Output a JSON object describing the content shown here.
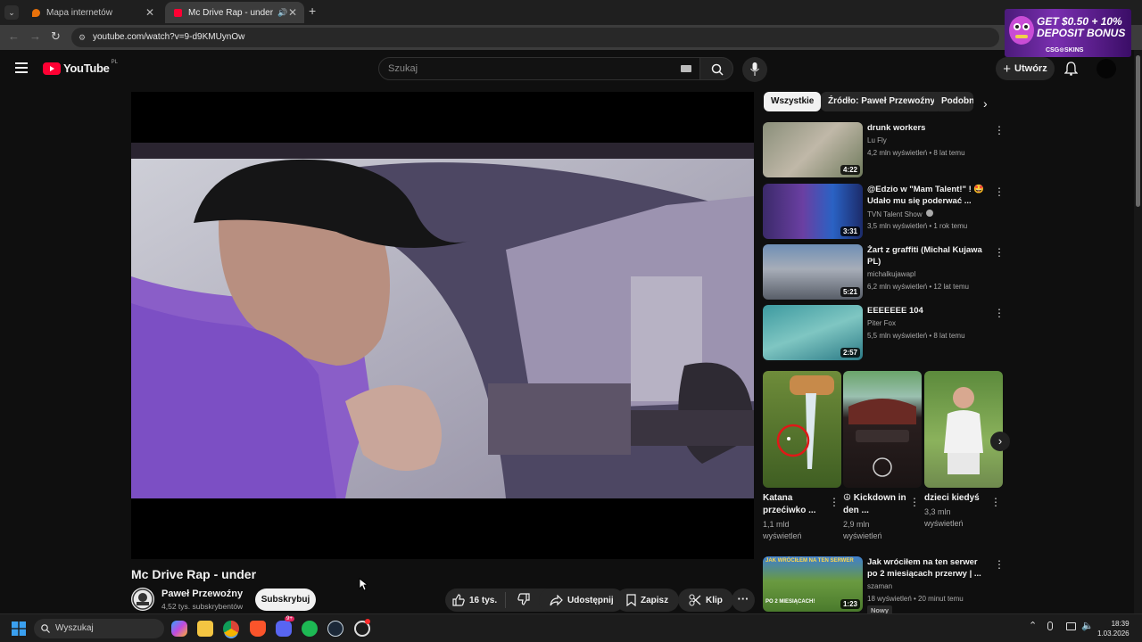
{
  "browser": {
    "tabs": [
      {
        "label": "Mapa internetów"
      },
      {
        "label": "Mc Drive Rap - under - You"
      }
    ],
    "url": "youtube.com/watch?v=9-d9KMUynOw"
  },
  "ad": {
    "headline_1": "GET $0.50 + 10%",
    "headline_2": "DEPOSIT BONUS",
    "brand": "CSG⊙SKINS"
  },
  "header": {
    "logo_text": "YouTube",
    "region": "PL",
    "search_placeholder": "Szukaj",
    "create_label": "Utwórz"
  },
  "video": {
    "title": "Mc Drive Rap - under",
    "channel_name": "Paweł Przewoźny",
    "subscribers": "4,52 tys. subskrybentów",
    "subscribe_label": "Subskrybuj",
    "likes": "16 tys.",
    "share_label": "Udostępnij",
    "save_label": "Zapisz",
    "clip_label": "Klip"
  },
  "chips": [
    "Wszystkie",
    "Źródło: Paweł Przewoźny",
    "Podobne"
  ],
  "recommendations": [
    {
      "title": "drunk workers",
      "channel": "Lu Fly",
      "meta": "4,2 mln wyświetleń • 8 lat temu",
      "duration": "4:22"
    },
    {
      "title": "@Edzio w \"Mam Talent!\" ! 🤩 Udało mu się poderwać ...",
      "channel": "TVN Talent Show",
      "meta": "3,5 mln wyświetleń • 1 rok temu",
      "duration": "3:31"
    },
    {
      "title": "Żart z graffiti (Michal Kujawa PL)",
      "channel": "michalkujawapl",
      "meta": "6,2 mln wyświetleń • 12 lat temu",
      "duration": "5:21"
    },
    {
      "title": "EEEEEEE 104",
      "channel": "Piter Fox",
      "meta": "5,5 mln wyświetleń • 8 lat temu",
      "duration": "2:57"
    }
  ],
  "shorts": [
    {
      "title": "Katana przećiwko ...",
      "views": "1,1 mld wyświetleń"
    },
    {
      "title": "☮ Kickdown in den ...",
      "views": "2,9 mln wyświetleń"
    },
    {
      "title": "dzieci kiedyś",
      "views": "3,3 mln wyświetleń"
    }
  ],
  "bottom_reco": {
    "title": "Jak wróciłem na ten serwer po 2 miesiącach przerwy | ...",
    "channel": "szaman",
    "meta": "18 wyświetleń • 20 minut temu",
    "badge": "Nowy",
    "duration": "1:23",
    "thumb_text_top": "JAK WRÓCIŁEM NA TEN SERWER",
    "thumb_text_bottom": "PO 2 MIESIĄCACH!"
  },
  "taskbar": {
    "search_placeholder": "Wyszukaj",
    "time": "18:39",
    "date": "1.03.2026",
    "discord_badge": "9+"
  }
}
